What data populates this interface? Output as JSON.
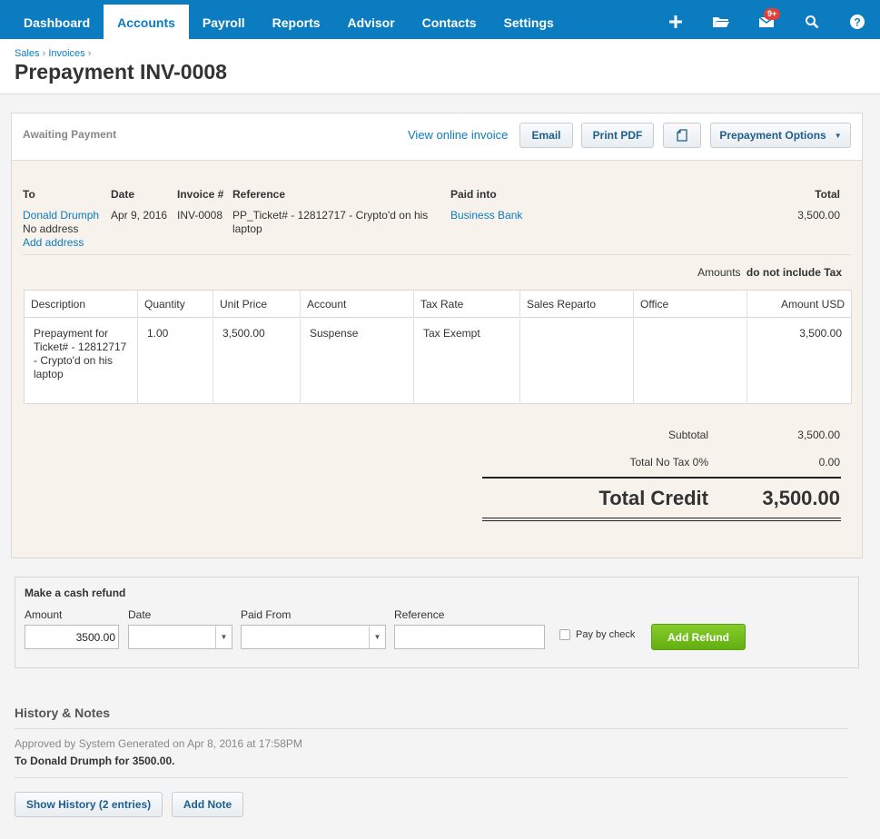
{
  "nav": {
    "items": [
      "Dashboard",
      "Accounts",
      "Payroll",
      "Reports",
      "Advisor",
      "Contacts",
      "Settings"
    ],
    "badge": "9+"
  },
  "breadcrumb": [
    "Sales",
    "Invoices"
  ],
  "title": "Prepayment INV-0008",
  "status": "Awaiting Payment",
  "actions": {
    "view_online": "View online invoice",
    "email": "Email",
    "print_pdf": "Print PDF",
    "options": "Prepayment Options"
  },
  "details": {
    "to_label": "To",
    "to_name": "Donald Drumph",
    "no_address": "No address",
    "add_address": "Add address",
    "date_label": "Date",
    "date": "Apr 9, 2016",
    "invoice_label": "Invoice #",
    "invoice": "INV-0008",
    "reference_label": "Reference",
    "reference": "PP_Ticket# - 12812717 - Crypto'd on his laptop",
    "paid_into_label": "Paid into",
    "paid_into": "Business Bank",
    "total_label": "Total",
    "total": "3,500.00"
  },
  "amounts_note": {
    "prefix": "Amounts",
    "emph": "do not include Tax"
  },
  "table": {
    "headers": [
      "Description",
      "Quantity",
      "Unit Price",
      "Account",
      "Tax Rate",
      "Sales Reparto",
      "Office",
      "Amount USD"
    ],
    "row": [
      "Prepayment for Ticket# - 12812717 - Crypto'd on his laptop",
      "1.00",
      "3,500.00",
      "Suspense",
      "Tax Exempt",
      "",
      "",
      "3,500.00"
    ]
  },
  "summary": {
    "subtotal_label": "Subtotal",
    "subtotal": "3,500.00",
    "tax_label": "Total No Tax 0%",
    "tax": "0.00",
    "total_label": "Total Credit",
    "total": "3,500.00"
  },
  "refund": {
    "title": "Make a cash refund",
    "amount_label": "Amount",
    "amount": "3500.00",
    "date_label": "Date",
    "paid_from_label": "Paid From",
    "reference_label": "Reference",
    "pay_by_check": "Pay by check",
    "button": "Add Refund"
  },
  "history": {
    "title": "History & Notes",
    "entry_meta": "Approved by System Generated on Apr 8, 2016 at 17:58PM",
    "entry_text": "To Donald Drumph for 3500.00.",
    "show_history": "Show History (2 entries)",
    "add_note": "Add Note"
  }
}
